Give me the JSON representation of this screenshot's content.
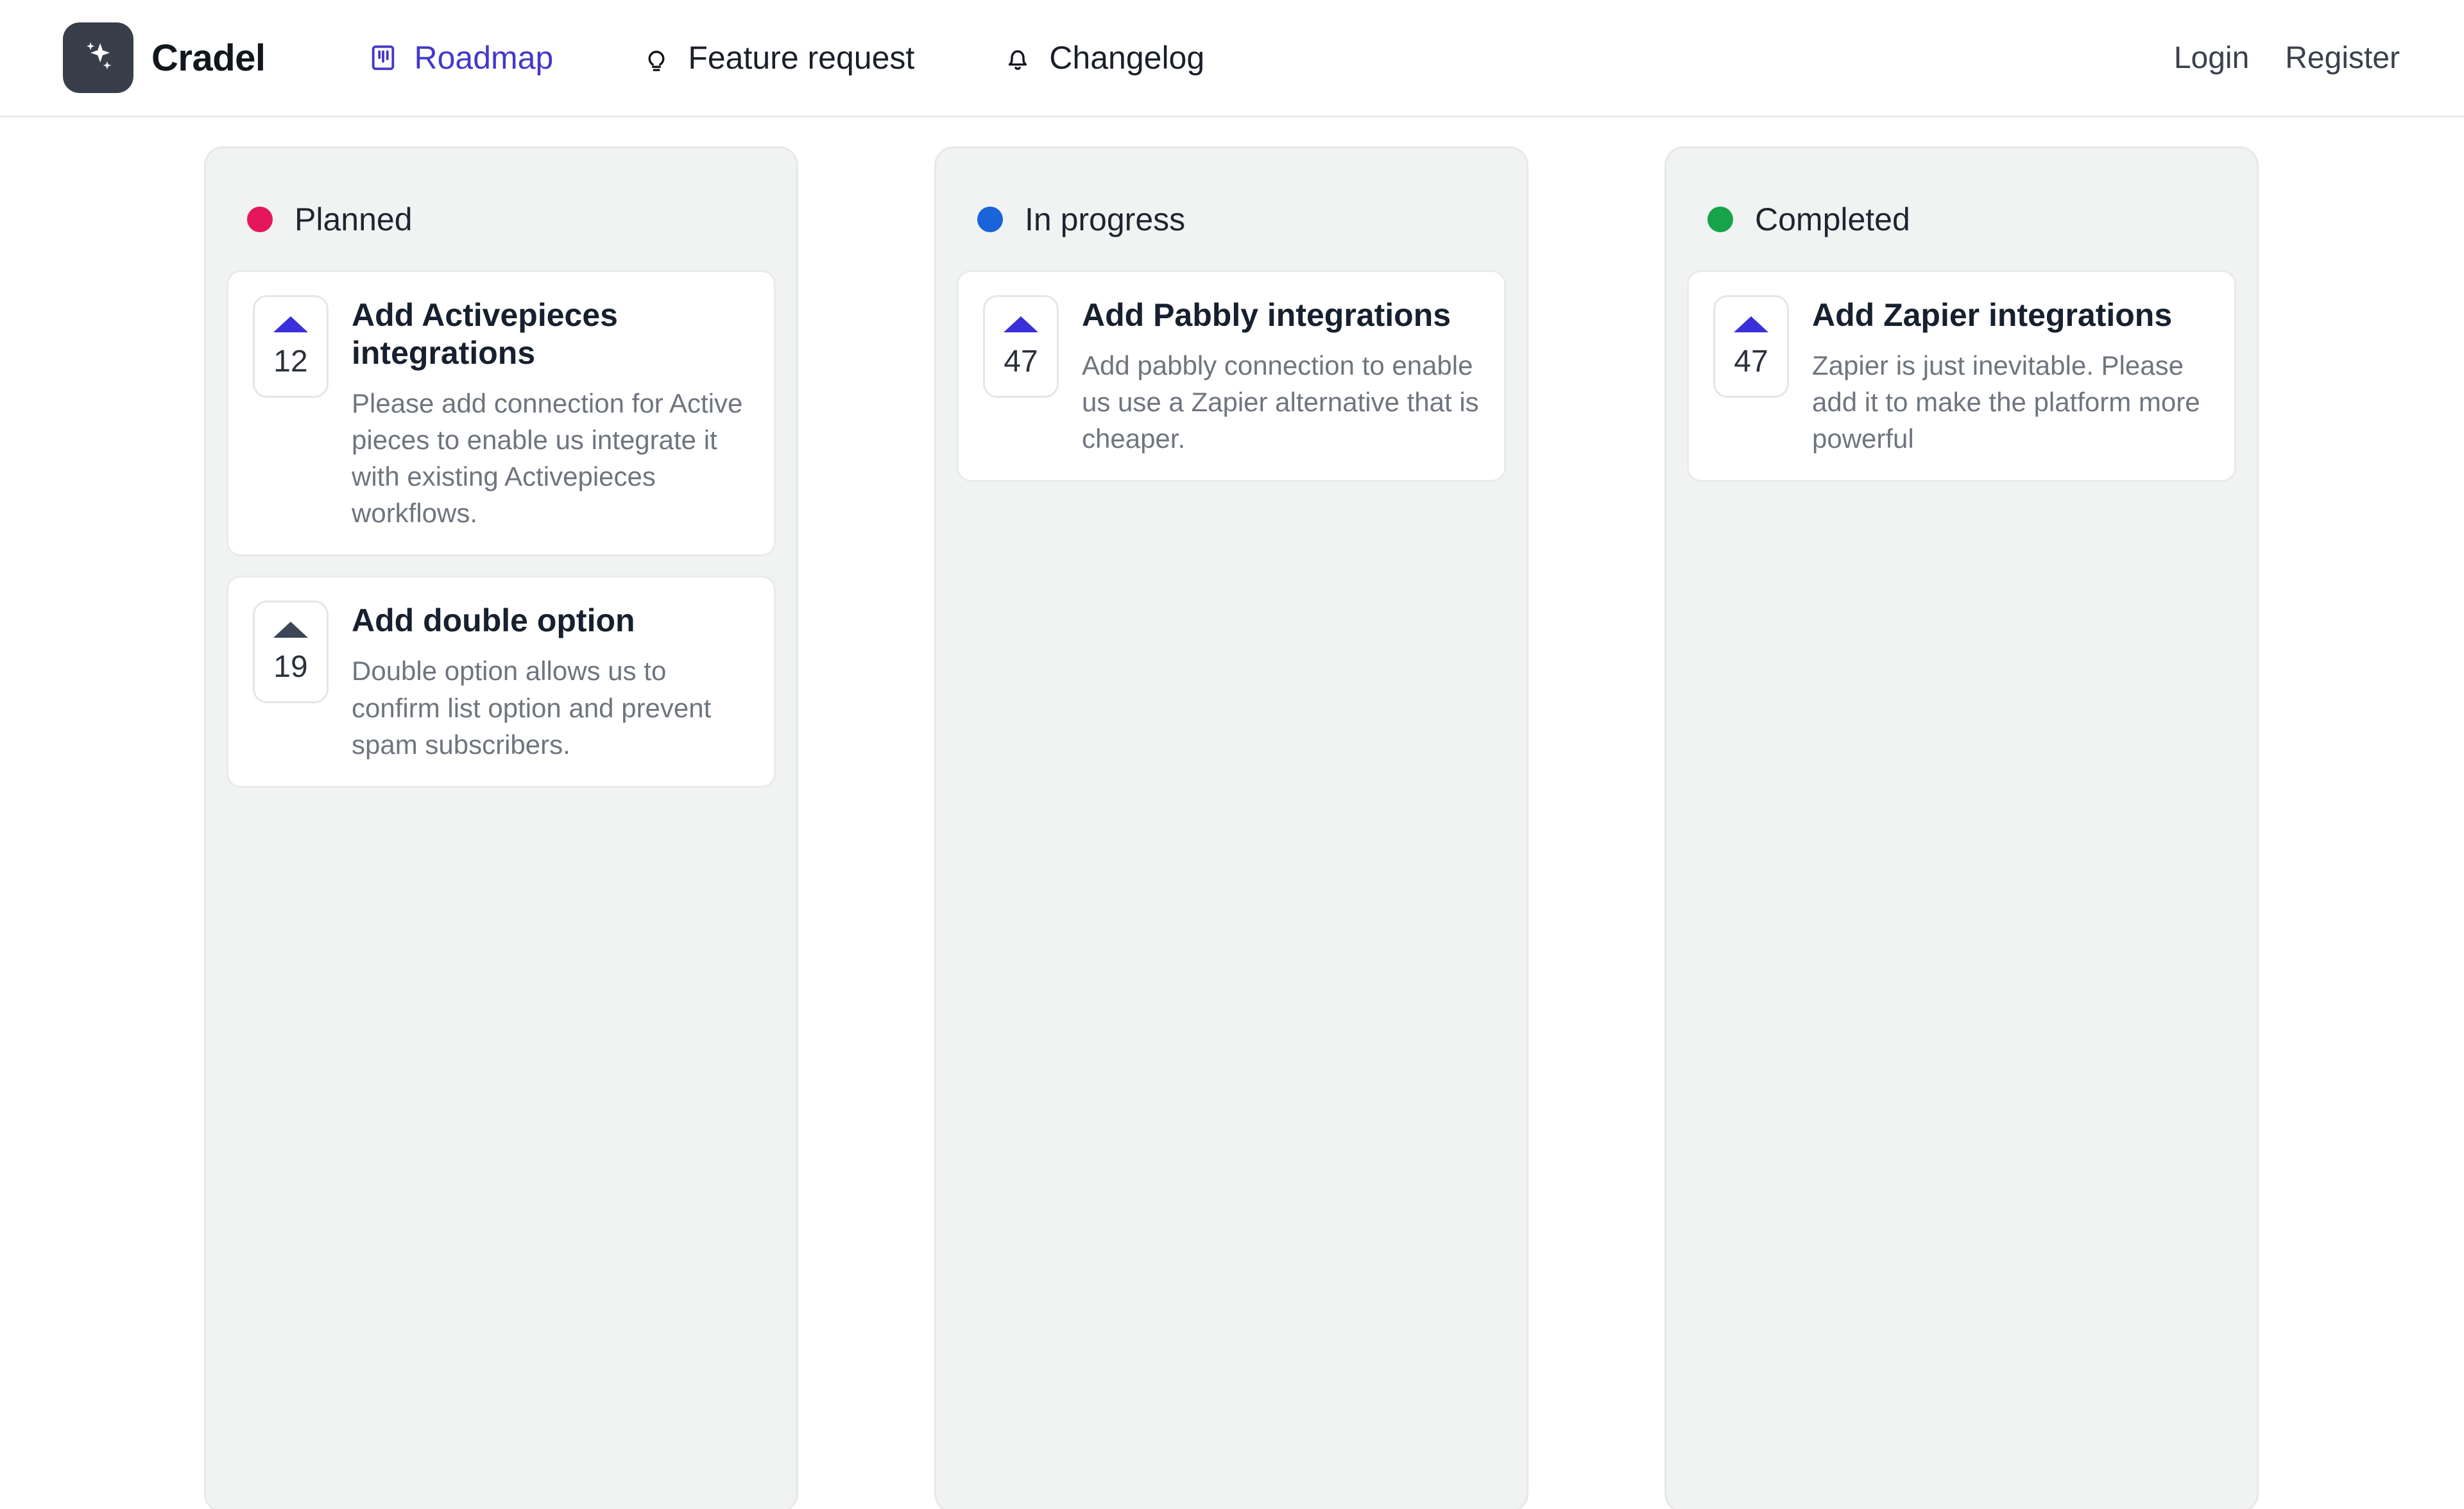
{
  "header": {
    "brand": {
      "name": "Cradel",
      "logo_icon": "sparkles-icon",
      "logo_bg": "#383f4a"
    },
    "nav": [
      {
        "label": "Roadmap",
        "icon": "kanban-board-icon",
        "active": true
      },
      {
        "label": "Feature request",
        "icon": "lightbulb-icon",
        "active": false
      },
      {
        "label": "Changelog",
        "icon": "bell-icon",
        "active": false
      }
    ],
    "auth": [
      {
        "label": "Login"
      },
      {
        "label": "Register"
      }
    ],
    "active_color": "#4338ca"
  },
  "board": {
    "columns": [
      {
        "title": "Planned",
        "dot_color": "#e5175c",
        "cards": [
          {
            "title": "Add Activepieces integrations",
            "description": "Please add connection for Active pieces to enable us integrate it with existing Activepieces workflows.",
            "votes": "12",
            "voted": true,
            "arrow_color": "#3a2fd8"
          },
          {
            "title": "Add double option",
            "description": "Double option allows us to confirm list option and prevent spam subscribers.",
            "votes": "19",
            "voted": false,
            "arrow_color": "#3d4654"
          }
        ]
      },
      {
        "title": "In progress",
        "dot_color": "#1a63d8",
        "cards": [
          {
            "title": "Add Pabbly integrations",
            "description": "Add pabbly connection to enable us use a Zapier alternative that is cheaper.",
            "votes": "47",
            "voted": true,
            "arrow_color": "#3a2fd8"
          }
        ]
      },
      {
        "title": "Completed",
        "dot_color": "#16a34a",
        "cards": [
          {
            "title": "Add Zapier integrations",
            "description": "Zapier is just inevitable. Please add it to make the platform more powerful",
            "votes": "47",
            "voted": true,
            "arrow_color": "#3a2fd8"
          }
        ]
      }
    ]
  }
}
